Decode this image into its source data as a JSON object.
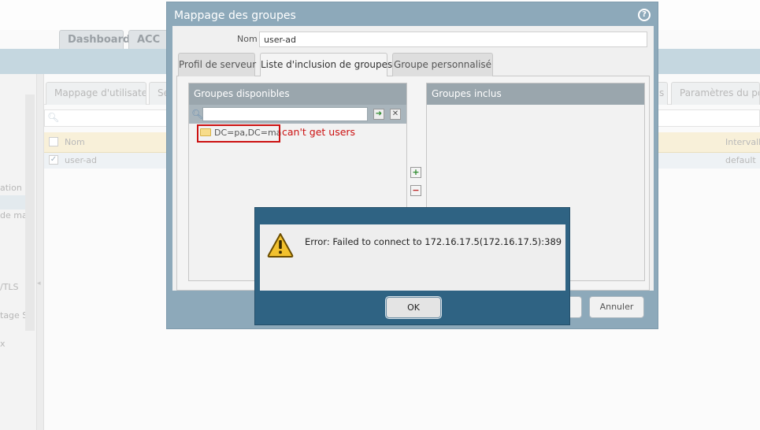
{
  "background": {
    "top_tabs": [
      "Dashboard",
      "ACC"
    ],
    "sub_tabs": [
      "Mappage d'utilisateur",
      "Se",
      "s",
      "Paramètres du portail"
    ],
    "sidebar_items": [
      "ation",
      "de ma",
      "/TLS",
      "tage S",
      "x"
    ],
    "table": {
      "columns": [
        "Nom",
        "Intervalle"
      ],
      "rows": [
        {
          "name": "user-ad",
          "interval": "default",
          "checked": true
        }
      ]
    }
  },
  "dialog": {
    "title": "Mappage des groupes",
    "help_icon": "?",
    "name_label": "Nom",
    "name_value": "user-ad",
    "tabs": [
      {
        "label": "Profil de serveur",
        "active": false
      },
      {
        "label": "Liste d'inclusion de groupes",
        "active": true
      },
      {
        "label": "Groupe personnalisé",
        "active": false
      }
    ],
    "available_groups": {
      "header": "Groupes disponibles",
      "search_value": "",
      "items": [
        "DC=pa,DC=ma"
      ]
    },
    "included_groups": {
      "header": "Groupes inclus",
      "items": []
    },
    "annotation": "can't get users",
    "buttons": {
      "ok": "",
      "cancel": "Annuler"
    }
  },
  "error_dialog": {
    "message": "Error: Failed to connect to 172.16.17.5(172.16.17.5):389",
    "ok_label": "OK",
    "icon": "warning-icon"
  },
  "colors": {
    "dialog_frame": "#8da9ba",
    "error_frame": "#2f6383",
    "list_header": "#9aa6ad",
    "annotation_red": "#cc1111"
  }
}
